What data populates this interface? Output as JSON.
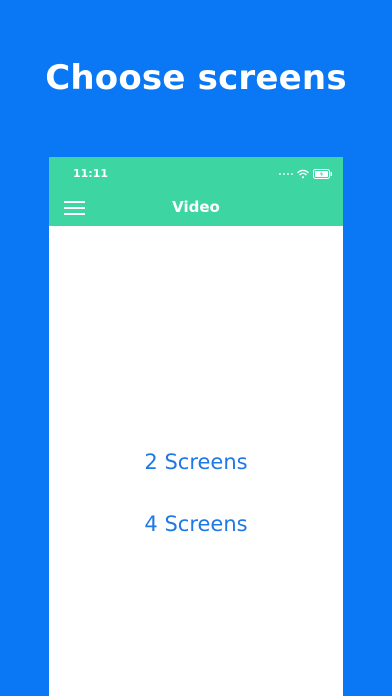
{
  "headline": "Choose screens",
  "status_bar": {
    "time": "11:11",
    "icons": [
      "signal-dots-icon",
      "wifi-icon",
      "battery-charging-icon"
    ]
  },
  "nav": {
    "title": "Video",
    "menu_icon": "hamburger-menu-icon"
  },
  "options": [
    {
      "label": "2 Screens"
    },
    {
      "label": "4 Screens"
    }
  ],
  "colors": {
    "background": "#0a78f5",
    "nav_bar": "#3dd6a3",
    "option_text": "#1e78e6",
    "screen": "#ffffff"
  }
}
